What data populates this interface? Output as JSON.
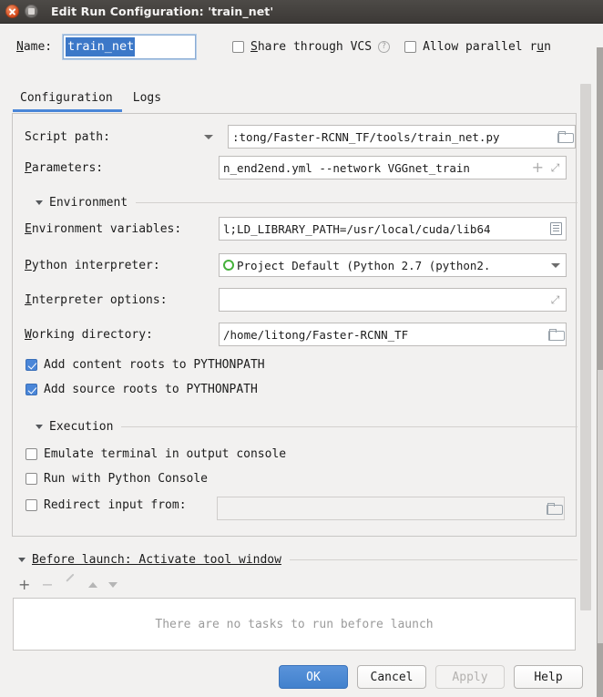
{
  "window": {
    "title": "Edit Run Configuration: 'train_net'",
    "close_icon": "close-icon",
    "maximize_icon": "maximize-icon"
  },
  "name_row": {
    "label": "Name:",
    "value": "train_net",
    "share_vcs": {
      "label": "Share through VCS",
      "checked": false,
      "help_icon": "?"
    },
    "allow_parallel": {
      "label": "Allow parallel run",
      "checked": false
    }
  },
  "tabs": [
    {
      "label": "Configuration",
      "selected": true
    },
    {
      "label": "Logs",
      "selected": false
    }
  ],
  "form": {
    "script_path": {
      "label": "Script path:",
      "value": ":tong/Faster-RCNN_TF/tools/train_net.py",
      "dropdown_icon": "chevron-down-icon",
      "browse_icon": "folder-icon"
    },
    "parameters": {
      "label": "Parameters:",
      "value": "n_end2end.yml --network VGGnet_train",
      "insert_icon": "plus-icon",
      "expand_icon": "expand-icon"
    },
    "environment_section": {
      "label": "Environment",
      "expanded": true
    },
    "environment_variables": {
      "label": "Environment variables:",
      "value": "l;LD_LIBRARY_PATH=/usr/local/cuda/lib64",
      "edit_icon": "list-icon"
    },
    "python_interpreter": {
      "label": "Python interpreter:",
      "value": "Project Default (Python 2.7 (python2.",
      "interpreter_icon": "python-icon",
      "dropdown_icon": "chevron-down-icon"
    },
    "interpreter_options": {
      "label": "Interpreter options:",
      "value": "",
      "expand_icon": "expand-icon"
    },
    "working_directory": {
      "label": "Working directory:",
      "value": "/home/litong/Faster-RCNN_TF",
      "browse_icon": "folder-icon"
    },
    "add_content_roots": {
      "label": "Add content roots to PYTHONPATH",
      "checked": true
    },
    "add_source_roots": {
      "label": "Add source roots to PYTHONPATH",
      "checked": true
    },
    "execution_section": {
      "label": "Execution",
      "expanded": true
    },
    "emulate_terminal": {
      "label": "Emulate terminal in output console",
      "checked": false
    },
    "run_with_python_console": {
      "label": "Run with Python Console",
      "checked": false
    },
    "redirect_input": {
      "label": "Redirect input from:",
      "checked": false,
      "value": "",
      "browse_icon": "folder-icon"
    }
  },
  "before_launch": {
    "title": "Before launch: Activate tool window",
    "expanded": true,
    "toolbar": {
      "add": "+",
      "remove": "−",
      "edit_icon": "pencil-icon",
      "move_up_icon": "arrow-up-icon",
      "move_down_icon": "arrow-down-icon"
    },
    "empty_message": "There are no tasks to run before launch"
  },
  "buttons": {
    "ok": "OK",
    "cancel": "Cancel",
    "apply": "Apply",
    "help": "Help"
  },
  "colors": {
    "accent": "#4a86d8",
    "titlebar": "#3c3936",
    "selection": "#3c78c8",
    "panel_bg": "#f2f1f0",
    "field_bg": "#ffffff"
  }
}
